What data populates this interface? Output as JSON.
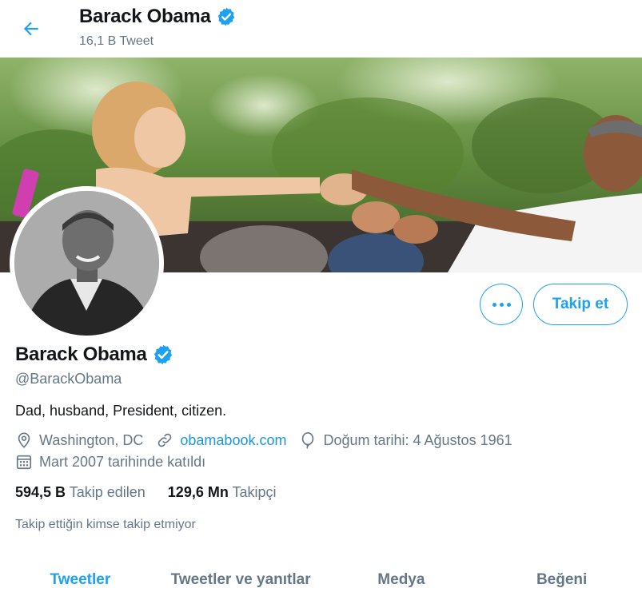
{
  "colors": {
    "accent": "#1da1f2",
    "link": "#1b95e0",
    "secondary_text": "#657786",
    "primary_text": "#14171a"
  },
  "header": {
    "back_icon": "arrow-left-icon",
    "name": "Barack Obama",
    "tweet_count": "16,1 B Tweet"
  },
  "actions": {
    "more_icon": "more-dots-icon",
    "follow_label": "Takip et"
  },
  "profile": {
    "name": "Barack Obama",
    "verified_icon": "verified-badge-icon",
    "handle": "@BarackObama",
    "bio": "Dad, husband, President, citizen.",
    "location": "Washington, DC",
    "website": "obamabook.com",
    "birthday": "Doğum tarihi: 4 Ağustos 1961",
    "joined": "Mart 2007 tarihinde katıldı"
  },
  "stats": {
    "following_count": "594,5 B",
    "following_label": "Takip edilen",
    "followers_count": "129,6 Mn",
    "followers_label": "Takipçi"
  },
  "follow_note": "Takip ettiğin kimse takip etmiyor",
  "tabs": [
    {
      "label": "Tweetler",
      "active": true
    },
    {
      "label": "Tweetler ve yanıtlar",
      "active": false
    },
    {
      "label": "Medya",
      "active": false
    },
    {
      "label": "Beğeni",
      "active": false
    }
  ]
}
